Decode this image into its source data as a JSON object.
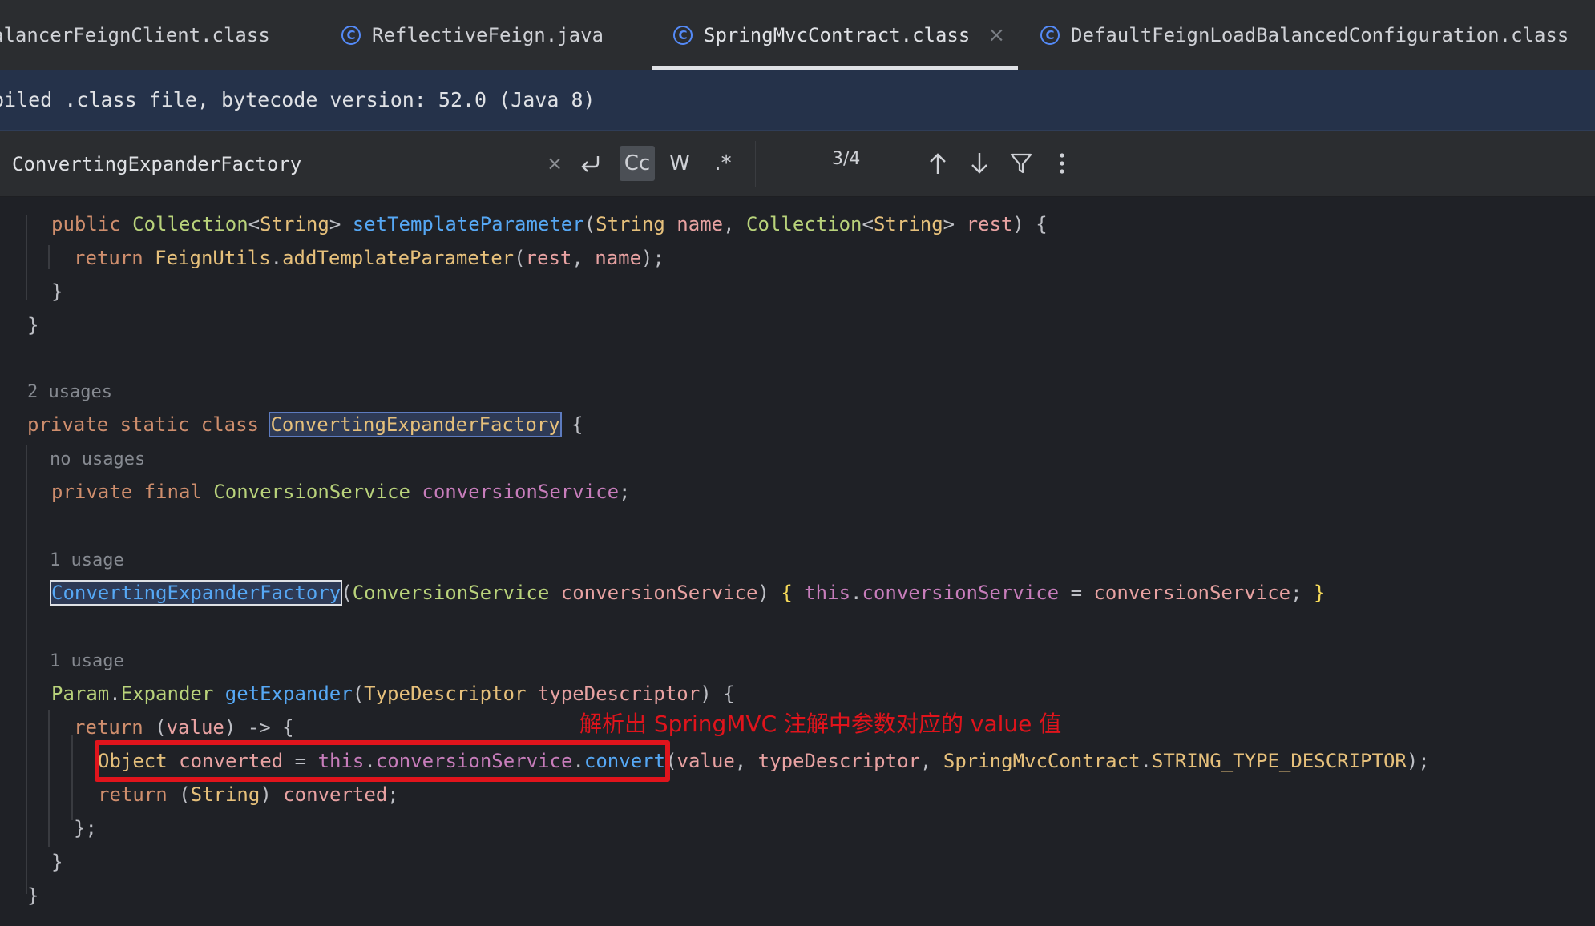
{
  "tabs": [
    {
      "label": "alancerFeignClient.class",
      "active": false,
      "has_icon": false
    },
    {
      "label": "ReflectiveFeign.java",
      "active": false,
      "has_icon": true
    },
    {
      "label": "SpringMvcContract.class",
      "active": true,
      "has_icon": true
    },
    {
      "label": "DefaultFeignLoadBalancedConfiguration.class",
      "active": false,
      "has_icon": true
    }
  ],
  "tab_close_glyph": "×",
  "notice": {
    "text": "piled .class file, bytecode version: 52.0 (Java 8)"
  },
  "find": {
    "query": "ConvertingExpanderFactory",
    "clear_glyph": "×",
    "match_case_label": "Cc",
    "words_label": "W",
    "regex_label": ".*",
    "count": "3/4"
  },
  "code": {
    "hint_2_usages": "2 usages",
    "hint_no_usages": "no usages",
    "hint_1_usage_a": "1 usage",
    "hint_1_usage_b": "1 usage"
  },
  "annotation": {
    "text": "解析出 SpringMVC 注解中参数对应的 value 值",
    "color": "#e0141c"
  },
  "colors": {
    "accent": "#548af7",
    "keyword": "#cf8e6d",
    "function": "#56a8f5",
    "field": "#c77dbb",
    "param": "#e8a2a2",
    "type": "#b9d37b"
  }
}
